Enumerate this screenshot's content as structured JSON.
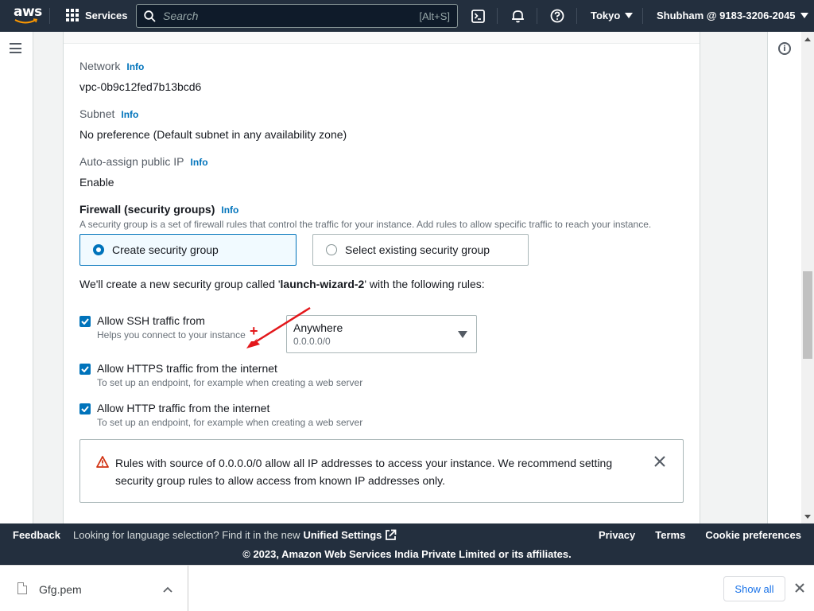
{
  "topnav": {
    "logo_text": "aws",
    "services_label": "Services",
    "search_placeholder": "Search",
    "search_shortcut": "[Alt+S]",
    "region": "Tokyo",
    "account": "Shubham @ 9183-3206-2045",
    "icons": [
      "cloudshell-icon",
      "bell-icon",
      "help-icon"
    ]
  },
  "content": {
    "network": {
      "label": "Network",
      "info": "Info",
      "value": "vpc-0b9c12fed7b13bcd6"
    },
    "subnet": {
      "label": "Subnet",
      "info": "Info",
      "value": "No preference (Default subnet in any availability zone)"
    },
    "auto_ip": {
      "label": "Auto-assign public IP",
      "info": "Info",
      "value": "Enable"
    },
    "firewall": {
      "label": "Firewall (security groups)",
      "info": "Info",
      "description": "A security group is a set of firewall rules that control the traffic for your instance. Add rules to allow specific traffic to reach your instance.",
      "options": [
        {
          "label": "Create security group",
          "selected": true
        },
        {
          "label": "Select existing security group",
          "selected": false
        }
      ],
      "note_prefix": "We'll create a new security group called '",
      "note_name": "launch-wizard-2",
      "note_suffix": "' with the following rules:"
    },
    "rules": [
      {
        "title": "Allow SSH traffic from",
        "subtitle": "Helps you connect to your instance",
        "checked": true
      },
      {
        "title": "Allow HTTPS traffic from the internet",
        "subtitle": "To set up an endpoint, for example when creating a web server",
        "checked": true
      },
      {
        "title": "Allow HTTP traffic from the internet",
        "subtitle": "To set up an endpoint, for example when creating a web server",
        "checked": true
      }
    ],
    "ssh_source": {
      "value": "Anywhere",
      "sub": "0.0.0.0/0"
    },
    "alert": {
      "message": "Rules with source of 0.0.0.0/0 allow all IP addresses to access your instance. We recommend setting security group rules to allow access from known IP addresses only."
    }
  },
  "footer": {
    "feedback": "Feedback",
    "lang_text": "Looking for language selection? Find it in the new",
    "lang_link": "Unified Settings",
    "links": [
      "Privacy",
      "Terms",
      "Cookie preferences"
    ],
    "copyright": "© 2023, Amazon Web Services India Private Limited or its affiliates."
  },
  "downloads": {
    "file_name": "Gfg.pem",
    "show_all": "Show all"
  },
  "colors": {
    "nav_bg": "#232f3e",
    "accent": "#0073bb",
    "warning": "#d13212",
    "annotation": "#e3171b"
  }
}
